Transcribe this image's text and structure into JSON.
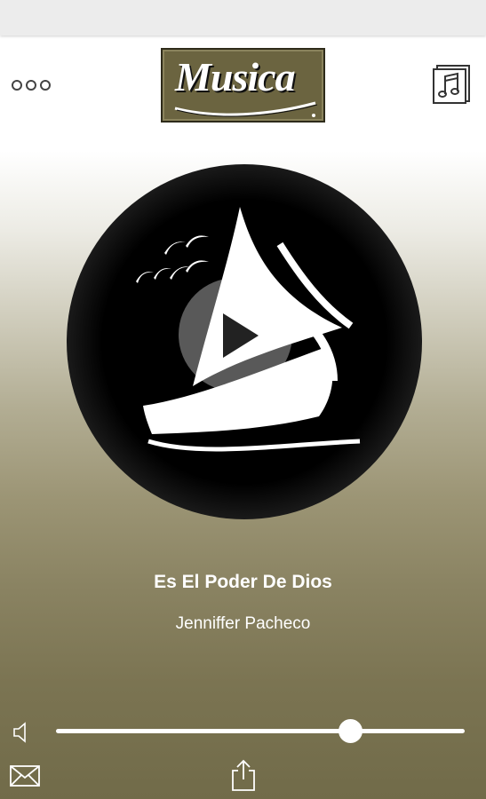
{
  "app": {
    "logo_text": "Musica"
  },
  "header": {
    "menu_icon": "more-dots-icon",
    "playlist_icon": "music-note-icon"
  },
  "player": {
    "artwork_icon": "sailboat-icon",
    "play_icon": "play-icon",
    "song_title": "Es El Poder De Dios",
    "artist": "Jenniffer Pacheco",
    "volume_fraction": 0.72
  },
  "footer": {
    "mail_icon": "mail-icon",
    "share_icon": "share-icon",
    "volume_icon": "speaker-icon"
  },
  "colors": {
    "accent_olive": "#716b49",
    "logo_background": "#6b6440",
    "text": "#ffffff"
  }
}
